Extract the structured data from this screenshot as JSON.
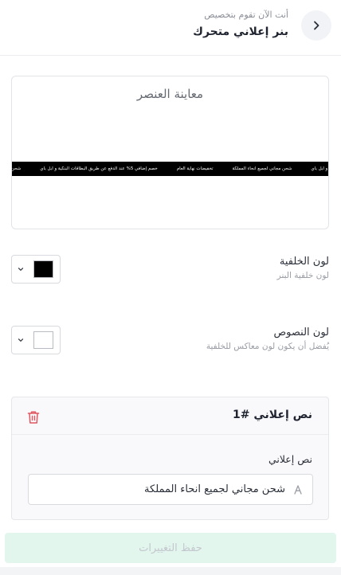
{
  "header": {
    "subtitle": "أنت الآن تقوم بتخصيص",
    "title": "بنر إعلاني متحرك"
  },
  "preview": {
    "title": "معاينة العنصر",
    "banner_items": [
      "اقات البنكية و ابل باي",
      "شحن مجاني لجميع انحاء المملكة",
      "تخفيضات نهاية العام",
      "خصم إضافي 5% عند الدفع عن طريق البطاقات البنكية و ابل باي",
      "شحن مجاني لجم"
    ],
    "banner_bg": "#000000",
    "banner_text_color": "#ffffff"
  },
  "background_color": {
    "label": "لون الخلفية",
    "hint": "لون خلفية البنر",
    "value": "#000000"
  },
  "text_color": {
    "label": "لون النصوص",
    "hint": "يُفضل أن يكون لون معاكس للخلفية",
    "value": "#ffffff"
  },
  "ad_text_card": {
    "title": "نص إعلاني #1",
    "field_label": "نص إعلاني",
    "field_value": "شحن مجاني لجميع انحاء المملكة",
    "delete_icon": "trash-icon",
    "field_icon": "text-icon"
  },
  "save_button": {
    "label": "حفظ التغييرات"
  },
  "colors": {
    "accent_light": "#e2f6ee",
    "danger": "#e0575f"
  }
}
